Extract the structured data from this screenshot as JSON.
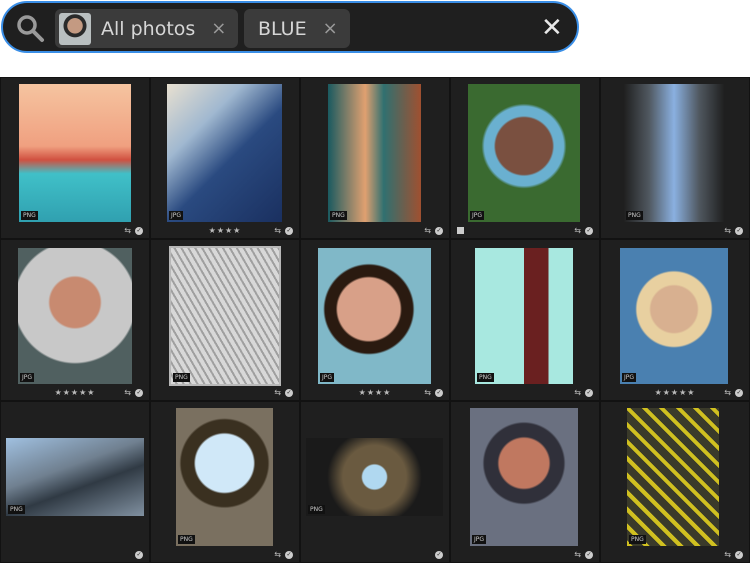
{
  "search": {
    "chips": [
      {
        "label": "All photos",
        "remove": "×"
      },
      {
        "label": "BLUE",
        "remove": "×"
      }
    ],
    "clear": "✕"
  },
  "tiles": [
    {
      "format": "PNG",
      "stars": ""
    },
    {
      "format": "JPG",
      "stars": "★★★★"
    },
    {
      "format": "PNG",
      "stars": ""
    },
    {
      "format": "JPG",
      "stars": "",
      "flag": true
    },
    {
      "format": "PNG",
      "stars": ""
    },
    {
      "format": "JPG",
      "stars": "★★★★★"
    },
    {
      "format": "PNG",
      "stars": ""
    },
    {
      "format": "JPG",
      "stars": "★★★★"
    },
    {
      "format": "PNG",
      "stars": ""
    },
    {
      "format": "JPG",
      "stars": "★★★★★"
    },
    {
      "format": "PNG",
      "stars": ""
    },
    {
      "format": "PNG",
      "stars": ""
    },
    {
      "format": "PNG",
      "stars": ""
    },
    {
      "format": "JPG",
      "stars": ""
    },
    {
      "format": "PNG",
      "stars": ""
    }
  ]
}
